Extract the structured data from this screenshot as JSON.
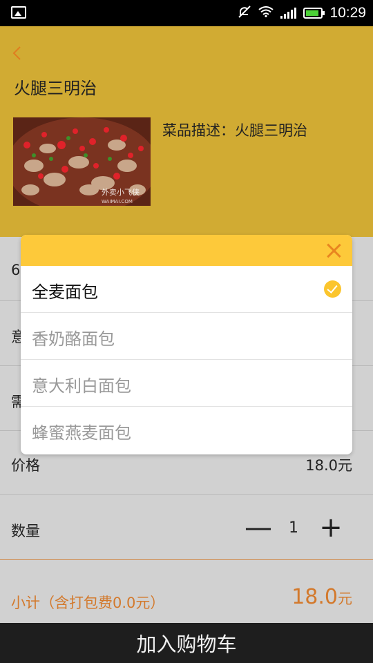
{
  "status_bar": {
    "time": "10:29"
  },
  "header": {
    "title": "火腿三明治",
    "description": "菜品描述：火腿三明治",
    "image_watermark": "外卖小飞侠",
    "image_watermark_sub": "WAIMAI.COM"
  },
  "rows": {
    "row1_partial": "6",
    "row2_partial": "意",
    "row3_partial": "需",
    "price_label": "价格",
    "price_value": "18.0元",
    "quantity_label": "数量",
    "quantity_value": "1",
    "minus_symbol": "—",
    "plus_symbol": "+"
  },
  "subtotal": {
    "label": "小计（含打包费0.0元）",
    "amount": "18.0",
    "unit": "元"
  },
  "cart_button": "加入购物车",
  "dialog": {
    "options": [
      {
        "label": "全麦面包",
        "selected": true
      },
      {
        "label": "香奶酪面包",
        "selected": false
      },
      {
        "label": "意大利白面包",
        "selected": false
      },
      {
        "label": "蜂蜜燕麦面包",
        "selected": false
      }
    ]
  },
  "colors": {
    "header_bg": "#d1ab33",
    "dialog_header": "#fdc93a",
    "accent_orange": "#d3792c",
    "check_yellow": "#fbc52d"
  }
}
